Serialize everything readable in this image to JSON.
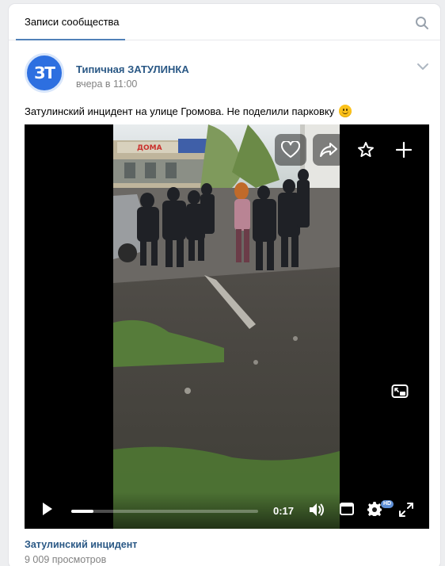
{
  "tabs": {
    "active_label": "Записи сообщества"
  },
  "post": {
    "avatar_text": "ЗТ",
    "author": "Типичная ЗАТУЛИНКА",
    "time": "вчера в 11:00",
    "text": "Затулинский инцидент на улице Громова. Не поделили парковку",
    "emoji": "slightly-smiling-face"
  },
  "video": {
    "overlay_actions": [
      "heart-icon",
      "share-icon",
      "star-icon",
      "plus-icon"
    ],
    "scene_sign": "ДОМА",
    "current_time": "0:17",
    "progress": 0.12,
    "quality_badge": "HD",
    "title": "Затулинский инцидент",
    "views": "9 009 просмотров"
  },
  "colors": {
    "link": "#2a5885",
    "accent": "#5181b8",
    "muted": "#828282",
    "background": "#edeef0"
  }
}
